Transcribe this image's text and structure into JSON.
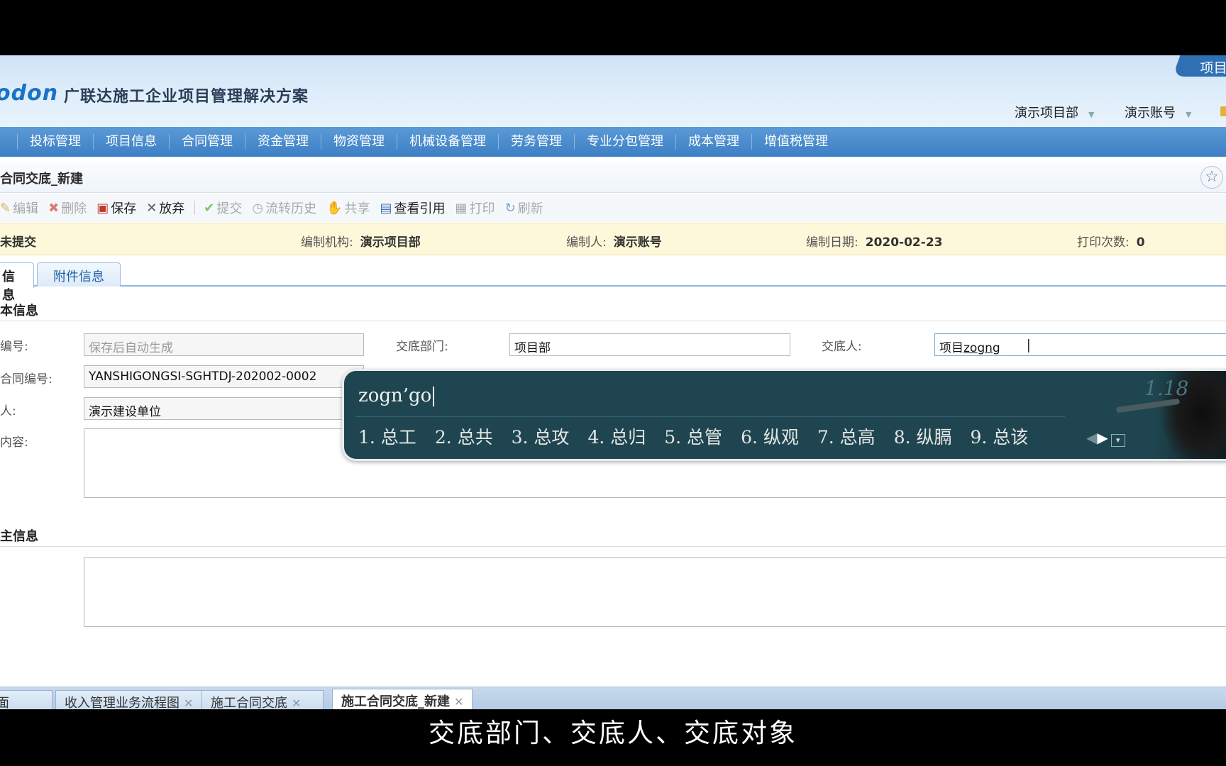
{
  "header": {
    "logo": "odon",
    "app_title": "广联达施工企业项目管理解决方案",
    "corner_tab": "项目",
    "dept_menu": "演示项目部",
    "account_menu": "演示账号"
  },
  "nav": {
    "items": [
      "投标管理",
      "项目信息",
      "合同管理",
      "资金管理",
      "物资管理",
      "机械设备管理",
      "劳务管理",
      "专业分包管理",
      "成本管理",
      "增值税管理"
    ]
  },
  "page": {
    "title": "合同交底_新建"
  },
  "toolbar": {
    "edit": "编辑",
    "delete": "删除",
    "save": "保存",
    "discard": "放弃",
    "submit": "提交",
    "flow_history": "流转历史",
    "share": "共享",
    "view_refs": "查看引用",
    "print": "打印",
    "refresh": "刷新"
  },
  "status": {
    "state": "未提交",
    "org_label": "编制机构:",
    "org_value": "演示项目部",
    "author_label": "编制人:",
    "author_value": "演示账号",
    "date_label": "编制日期:",
    "date_value": "2020-02-23",
    "print_label": "打印次数:",
    "print_value": "0"
  },
  "tabs": {
    "basic": "信息",
    "attachments": "附件信息"
  },
  "basic_section": {
    "title": "本信息",
    "code_label": "编号:",
    "code_placeholder": "保存后自动生成",
    "dept_label": "交底部门:",
    "dept_value": "项目部",
    "person_label": "交底人:",
    "person_value_prefix": "项目",
    "person_value_typed": "zogng",
    "contract_label": "合同编号:",
    "contract_value": "YANSHIGONGSI-SGHTDJ-202002-0002",
    "party_label": "人:",
    "party_value": "演示建设单位",
    "content_label": "内容:"
  },
  "other_section": {
    "title": "主信息"
  },
  "ime": {
    "input": "zogn’go",
    "version": "1.18",
    "candidates": [
      "1. 总工",
      "2. 总共",
      "3. 总攻",
      "4. 总归",
      "5. 总管",
      "6. 纵观",
      "7. 总高",
      "8. 纵膈",
      "9. 总该"
    ]
  },
  "bottom_tabs": {
    "tab1": "面",
    "tab2": "收入管理业务流程图",
    "tab3": "施工合同交底",
    "tab4": "施工合同交底_新建"
  },
  "subtitle": "交底部门、交底人、交底对象",
  "colors": {
    "nav_blue": "#3c7fc4",
    "status_yellow": "#fdf8d9",
    "ime_bg": "#1f4650"
  }
}
